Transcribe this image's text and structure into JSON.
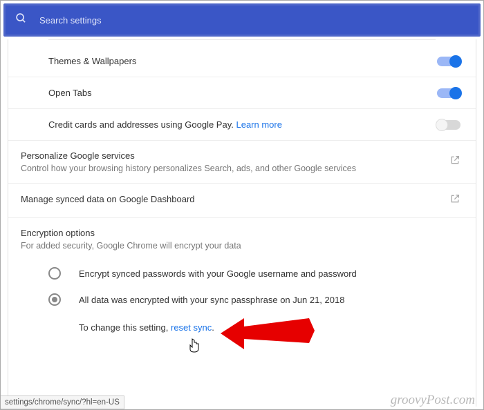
{
  "search": {
    "placeholder": "Search settings"
  },
  "rows": {
    "themes": {
      "label": "Themes & Wallpapers",
      "on": true
    },
    "tabs": {
      "label": "Open Tabs",
      "on": true
    },
    "cc": {
      "label": "Credit cards and addresses using Google Pay.",
      "learn": "Learn more",
      "on": false
    }
  },
  "personalize": {
    "title": "Personalize Google services",
    "sub": "Control how your browsing history personalizes Search, ads, and other Google services"
  },
  "manage": {
    "title": "Manage synced data on Google Dashboard"
  },
  "encryption": {
    "title": "Encryption options",
    "sub": "For added security, Google Chrome will encrypt your data",
    "opt1": "Encrypt synced passwords with your Google username and password",
    "opt2": "All data was encrypted with your sync passphrase on Jun 21, 2018",
    "note_prefix": "To change this setting, ",
    "note_link": "reset sync",
    "note_suffix": "."
  },
  "status": "settings/chrome/sync/?hl=en-US",
  "watermark": "groovyPost.com"
}
